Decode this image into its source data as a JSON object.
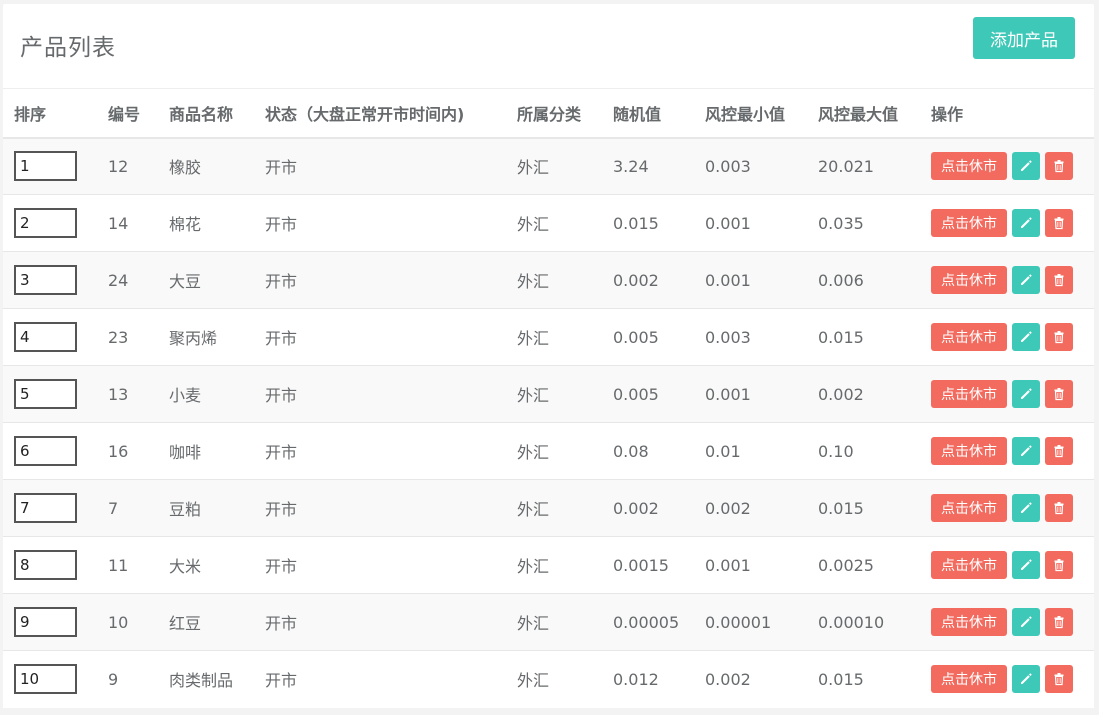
{
  "header": {
    "title": "产品列表",
    "add_label": "添加产品"
  },
  "table": {
    "columns": [
      "排序",
      "编号",
      "商品名称",
      "状态（大盘正常开市时间内)",
      "所属分类",
      "随机值",
      "风控最小值",
      "风控最大值",
      "操作"
    ],
    "rows": [
      {
        "sort": "1",
        "id": "12",
        "name": "橡胶",
        "status": "开市",
        "category": "外汇",
        "random": "3.24",
        "min": "0.003",
        "max": "20.021",
        "action": "点击休市"
      },
      {
        "sort": "2",
        "id": "14",
        "name": "棉花",
        "status": "开市",
        "category": "外汇",
        "random": "0.015",
        "min": "0.001",
        "max": "0.035",
        "action": "点击休市"
      },
      {
        "sort": "3",
        "id": "24",
        "name": "大豆",
        "status": "开市",
        "category": "外汇",
        "random": "0.002",
        "min": "0.001",
        "max": "0.006",
        "action": "点击休市"
      },
      {
        "sort": "4",
        "id": "23",
        "name": "聚丙烯",
        "status": "开市",
        "category": "外汇",
        "random": "0.005",
        "min": "0.003",
        "max": "0.015",
        "action": "点击休市"
      },
      {
        "sort": "5",
        "id": "13",
        "name": "小麦",
        "status": "开市",
        "category": "外汇",
        "random": "0.005",
        "min": "0.001",
        "max": "0.002",
        "action": "点击休市"
      },
      {
        "sort": "6",
        "id": "16",
        "name": "咖啡",
        "status": "开市",
        "category": "外汇",
        "random": "0.08",
        "min": "0.01",
        "max": "0.10",
        "action": "点击休市"
      },
      {
        "sort": "7",
        "id": "7",
        "name": "豆粕",
        "status": "开市",
        "category": "外汇",
        "random": "0.002",
        "min": "0.002",
        "max": "0.015",
        "action": "点击休市"
      },
      {
        "sort": "8",
        "id": "11",
        "name": "大米",
        "status": "开市",
        "category": "外汇",
        "random": "0.0015",
        "min": "0.001",
        "max": "0.0025",
        "action": "点击休市"
      },
      {
        "sort": "9",
        "id": "10",
        "name": "红豆",
        "status": "开市",
        "category": "外汇",
        "random": "0.00005",
        "min": "0.00001",
        "max": "0.00010",
        "action": "点击休市"
      },
      {
        "sort": "10",
        "id": "9",
        "name": "肉类制品",
        "status": "开市",
        "category": "外汇",
        "random": "0.012",
        "min": "0.002",
        "max": "0.015",
        "action": "点击休市"
      }
    ]
  },
  "icons": {
    "edit": "pencil-icon",
    "delete": "trash-icon"
  },
  "colors": {
    "primary": "#3ec8b8",
    "danger": "#f36b5f"
  }
}
